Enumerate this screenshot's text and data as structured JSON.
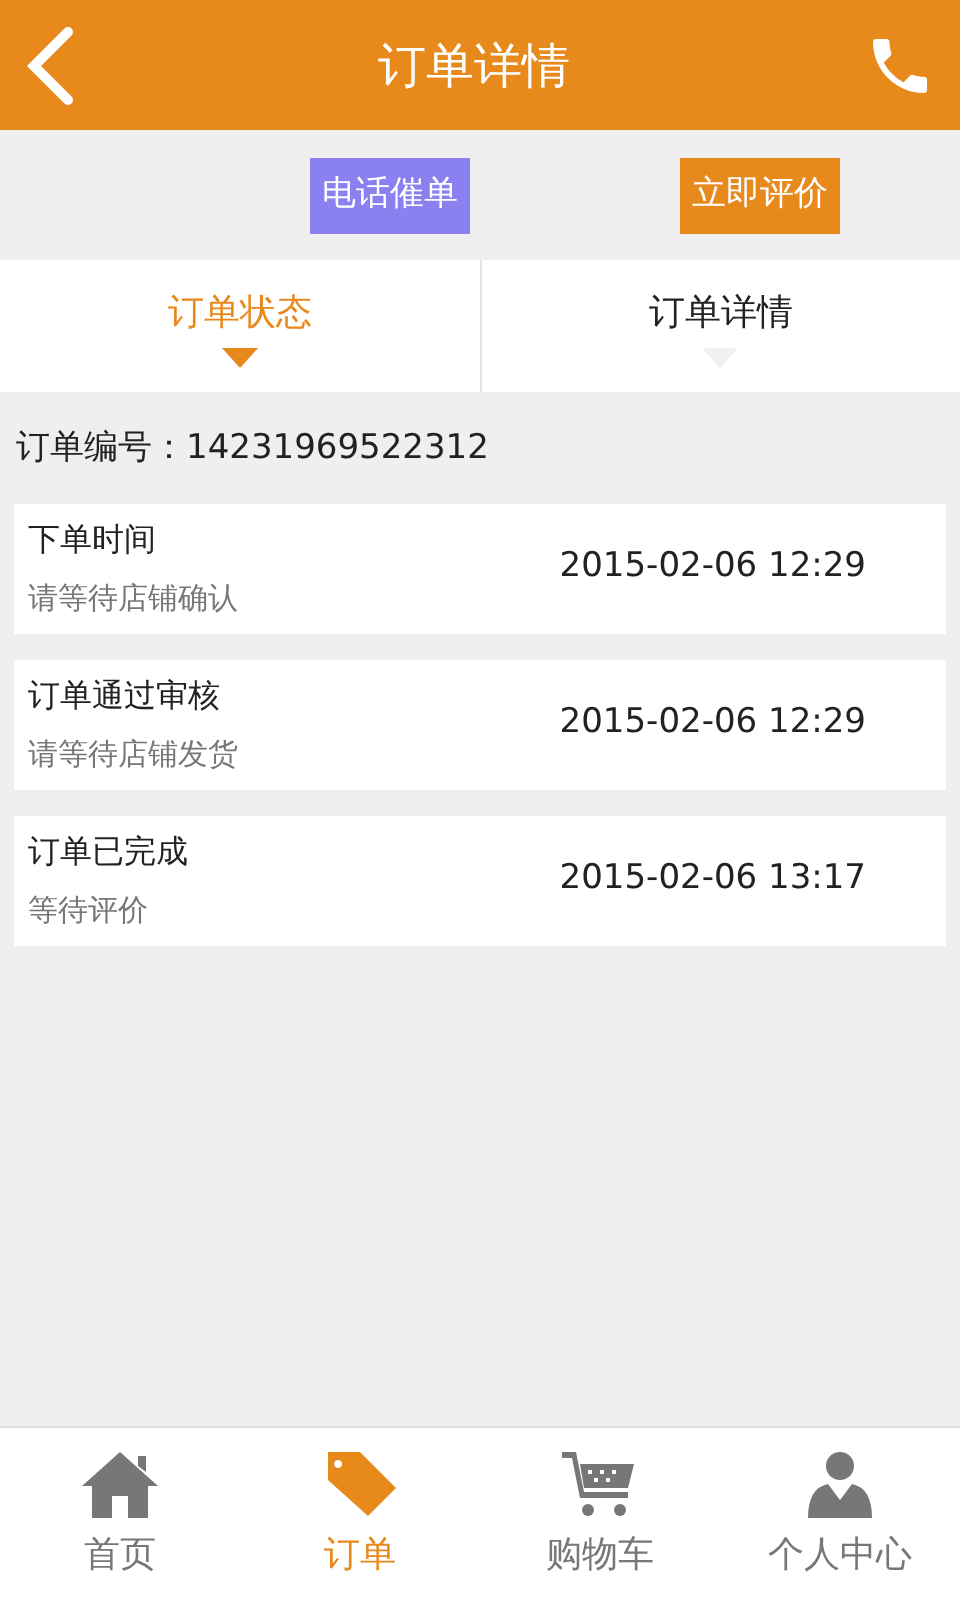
{
  "header": {
    "title": "订单详情"
  },
  "actions": [
    {
      "label": "电话催单",
      "color": "#8b80f0"
    },
    {
      "label": "立即评价",
      "color": "#e8891b"
    }
  ],
  "tabs": [
    {
      "label": "订单状态",
      "selected": true
    },
    {
      "label": "订单详情",
      "selected": false
    }
  ],
  "order_number": "订单编号：14231969522312",
  "events": [
    {
      "title": "下单时间",
      "note": "请等待店铺确认",
      "time": "2015-02-06 12:29"
    },
    {
      "title": "订单通过审核",
      "note": "请等待店铺发货",
      "time": "2015-02-06 12:29"
    },
    {
      "title": "订单已完成",
      "note": "等待评价",
      "time": "2015-02-06 13:17"
    }
  ],
  "nav": [
    {
      "label": "首页",
      "kind": "home",
      "selected": false
    },
    {
      "label": "订单",
      "kind": "tag",
      "selected": true
    },
    {
      "label": "购物车",
      "kind": "cart",
      "selected": false
    },
    {
      "label": "个人中心",
      "kind": "person",
      "selected": false
    }
  ]
}
